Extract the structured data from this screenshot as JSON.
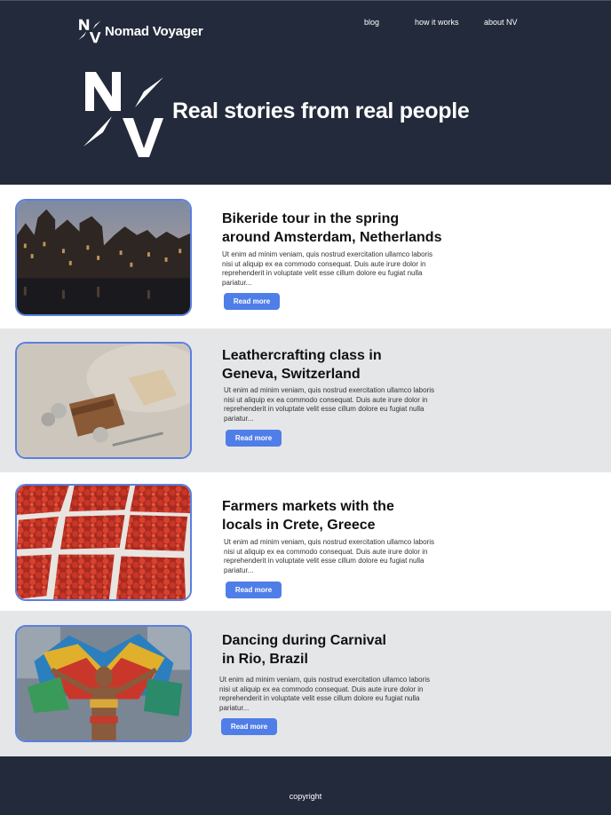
{
  "header": {
    "brand_name": "Nomad Voyager",
    "nav": [
      "blog",
      "how it works",
      "about NV"
    ],
    "hero_title": "Real stories from real people"
  },
  "stories": [
    {
      "title_line1": "Bikeride tour in the spring",
      "title_line2": "around Amsterdam, Netherlands",
      "body": "Ut enim ad minim veniam, quis nostrud exercitation ullamco laboris nisi ut aliquip ex ea commodo consequat. Duis aute irure dolor in reprehenderit in voluptate velit esse cillum dolore eu fugiat nulla pariatur...",
      "button": "Read more"
    },
    {
      "title_line1": "Leathercrafting class in",
      "title_line2": "Geneva, Switzerland",
      "body": "Ut enim ad minim veniam, quis nostrud exercitation ullamco laboris nisi ut aliquip ex ea commodo consequat. Duis aute irure dolor in reprehenderit in voluptate velit esse cillum dolore eu fugiat nulla pariatur...",
      "button": "Read more"
    },
    {
      "title_line1": "Farmers markets with the",
      "title_line2": "locals in Crete, Greece",
      "body": "Ut enim ad minim veniam, quis nostrud exercitation ullamco laboris nisi ut aliquip ex ea commodo consequat. Duis aute irure dolor in reprehenderit in voluptate velit esse cillum dolore eu fugiat nulla pariatur...",
      "button": "Read more"
    },
    {
      "title_line1": "Dancing during Carnival",
      "title_line2": "in Rio, Brazil",
      "body": "Ut enim ad minim veniam, quis nostrud exercitation ullamco laboris nisi ut aliquip ex ea commodo consequat. Duis aute irure dolor in reprehenderit in voluptate velit esse cillum dolore eu fugiat nulla pariatur...",
      "button": "Read more"
    }
  ],
  "footer": {
    "copyright": "copyright"
  },
  "colors": {
    "header_bg": "#232a3b",
    "alt_row_bg": "#e5e6e8",
    "accent": "#4f7ee8",
    "thumb_border": "#5a7fe0"
  }
}
